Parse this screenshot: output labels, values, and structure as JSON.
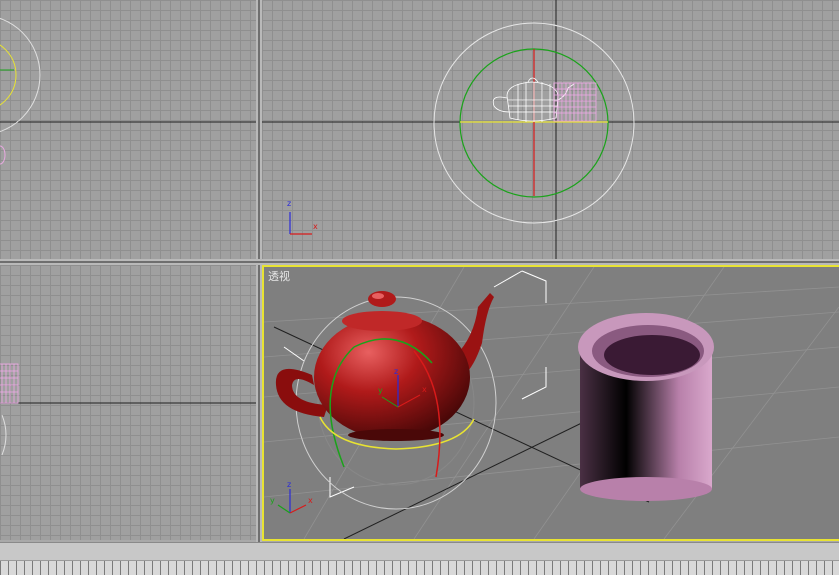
{
  "viewports": {
    "top_left": {
      "label": ""
    },
    "top_right": {
      "label": ""
    },
    "bottom_left": {
      "label": ""
    },
    "perspective": {
      "label": "透视"
    }
  },
  "axis_labels": {
    "front_up": "z",
    "front_right": "x",
    "persp_x": "x",
    "persp_y": "y",
    "persp_z": "z"
  },
  "colors": {
    "selection_border": "#e8e332",
    "teapot": "#b01a1a",
    "cylinder": "#b880aa",
    "gizmo_green": "#1aa31a",
    "gizmo_yellow": "#e8e332",
    "axis_red": "#d81a1a"
  }
}
